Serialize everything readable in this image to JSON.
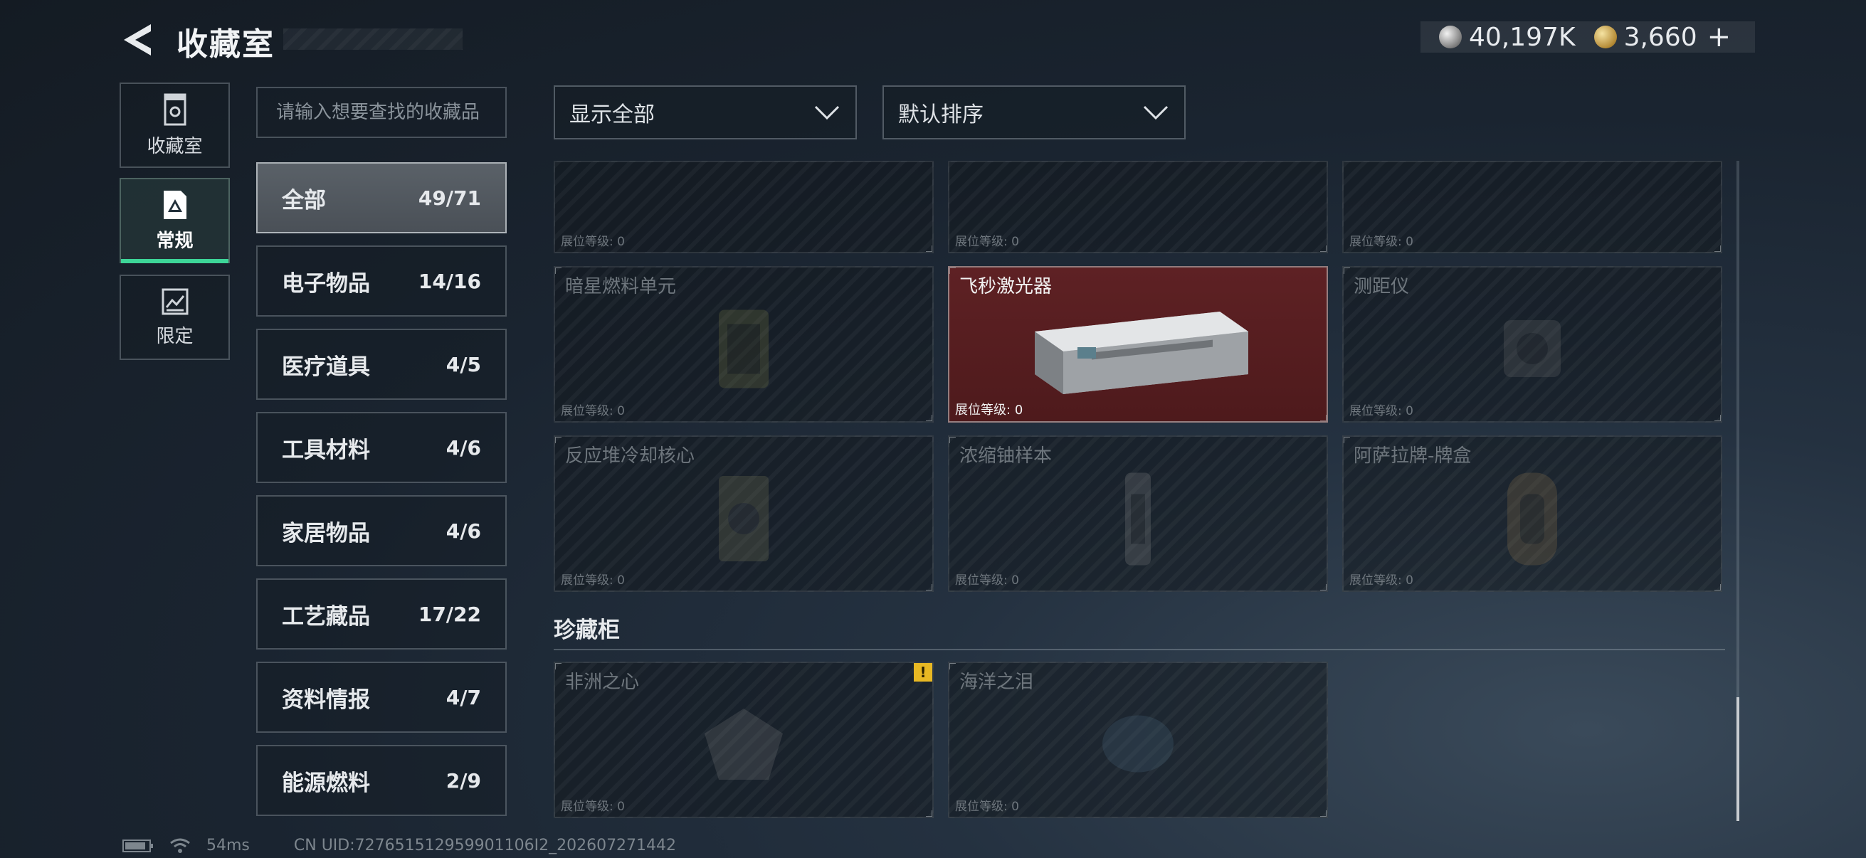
{
  "header": {
    "title": "收藏室",
    "back_icon": "back-arrow-icon",
    "currency": [
      {
        "icon": "silver-coin-icon",
        "value": "40,197K"
      },
      {
        "icon": "gold-coin-icon",
        "value": "3,660"
      }
    ],
    "add_symbol": "+"
  },
  "nav": [
    {
      "label": "收藏室",
      "icon": "collection-room-icon"
    },
    {
      "label": "常规",
      "icon": "regular-icon",
      "active": true,
      "accent": "#3dd598"
    },
    {
      "label": "限定",
      "icon": "limited-icon"
    }
  ],
  "search": {
    "placeholder": "请输入想要查找的收藏品"
  },
  "filters": {
    "show": "显示全部",
    "sort": "默认排序"
  },
  "categories": [
    {
      "name": "全部",
      "count": "49/71",
      "active": true
    },
    {
      "name": "电子物品",
      "count": "14/16"
    },
    {
      "name": "医疗道具",
      "count": "4/5"
    },
    {
      "name": "工具材料",
      "count": "4/6"
    },
    {
      "name": "家居物品",
      "count": "4/6"
    },
    {
      "name": "工艺藏品",
      "count": "17/22"
    },
    {
      "name": "资料情报",
      "count": "4/7"
    },
    {
      "name": "能源燃料",
      "count": "2/9"
    }
  ],
  "level_label": "展位等级:",
  "items_top": [
    {
      "level": "0"
    },
    {
      "level": "0"
    },
    {
      "level": "0"
    }
  ],
  "items": [
    {
      "name": "暗星燃料单元",
      "level": "0"
    },
    {
      "name": "飞秒激光器",
      "level": "0",
      "highlight": true,
      "highlight_color": "#5e2124"
    },
    {
      "name": "测距仪",
      "level": "0"
    },
    {
      "name": "反应堆冷却核心",
      "level": "0"
    },
    {
      "name": "浓缩铀样本",
      "level": "0"
    },
    {
      "name": "阿萨拉牌-牌盒",
      "level": "0"
    }
  ],
  "section_title": "珍藏柜",
  "treasure_items": [
    {
      "name": "非洲之心",
      "level": "0",
      "badge": "!",
      "badge_color": "#e8b823"
    },
    {
      "name": "海洋之泪",
      "level": "0"
    }
  ],
  "footer": {
    "ping": "54ms",
    "uid": "CN UID:727651512959901106I2_202607271442"
  }
}
